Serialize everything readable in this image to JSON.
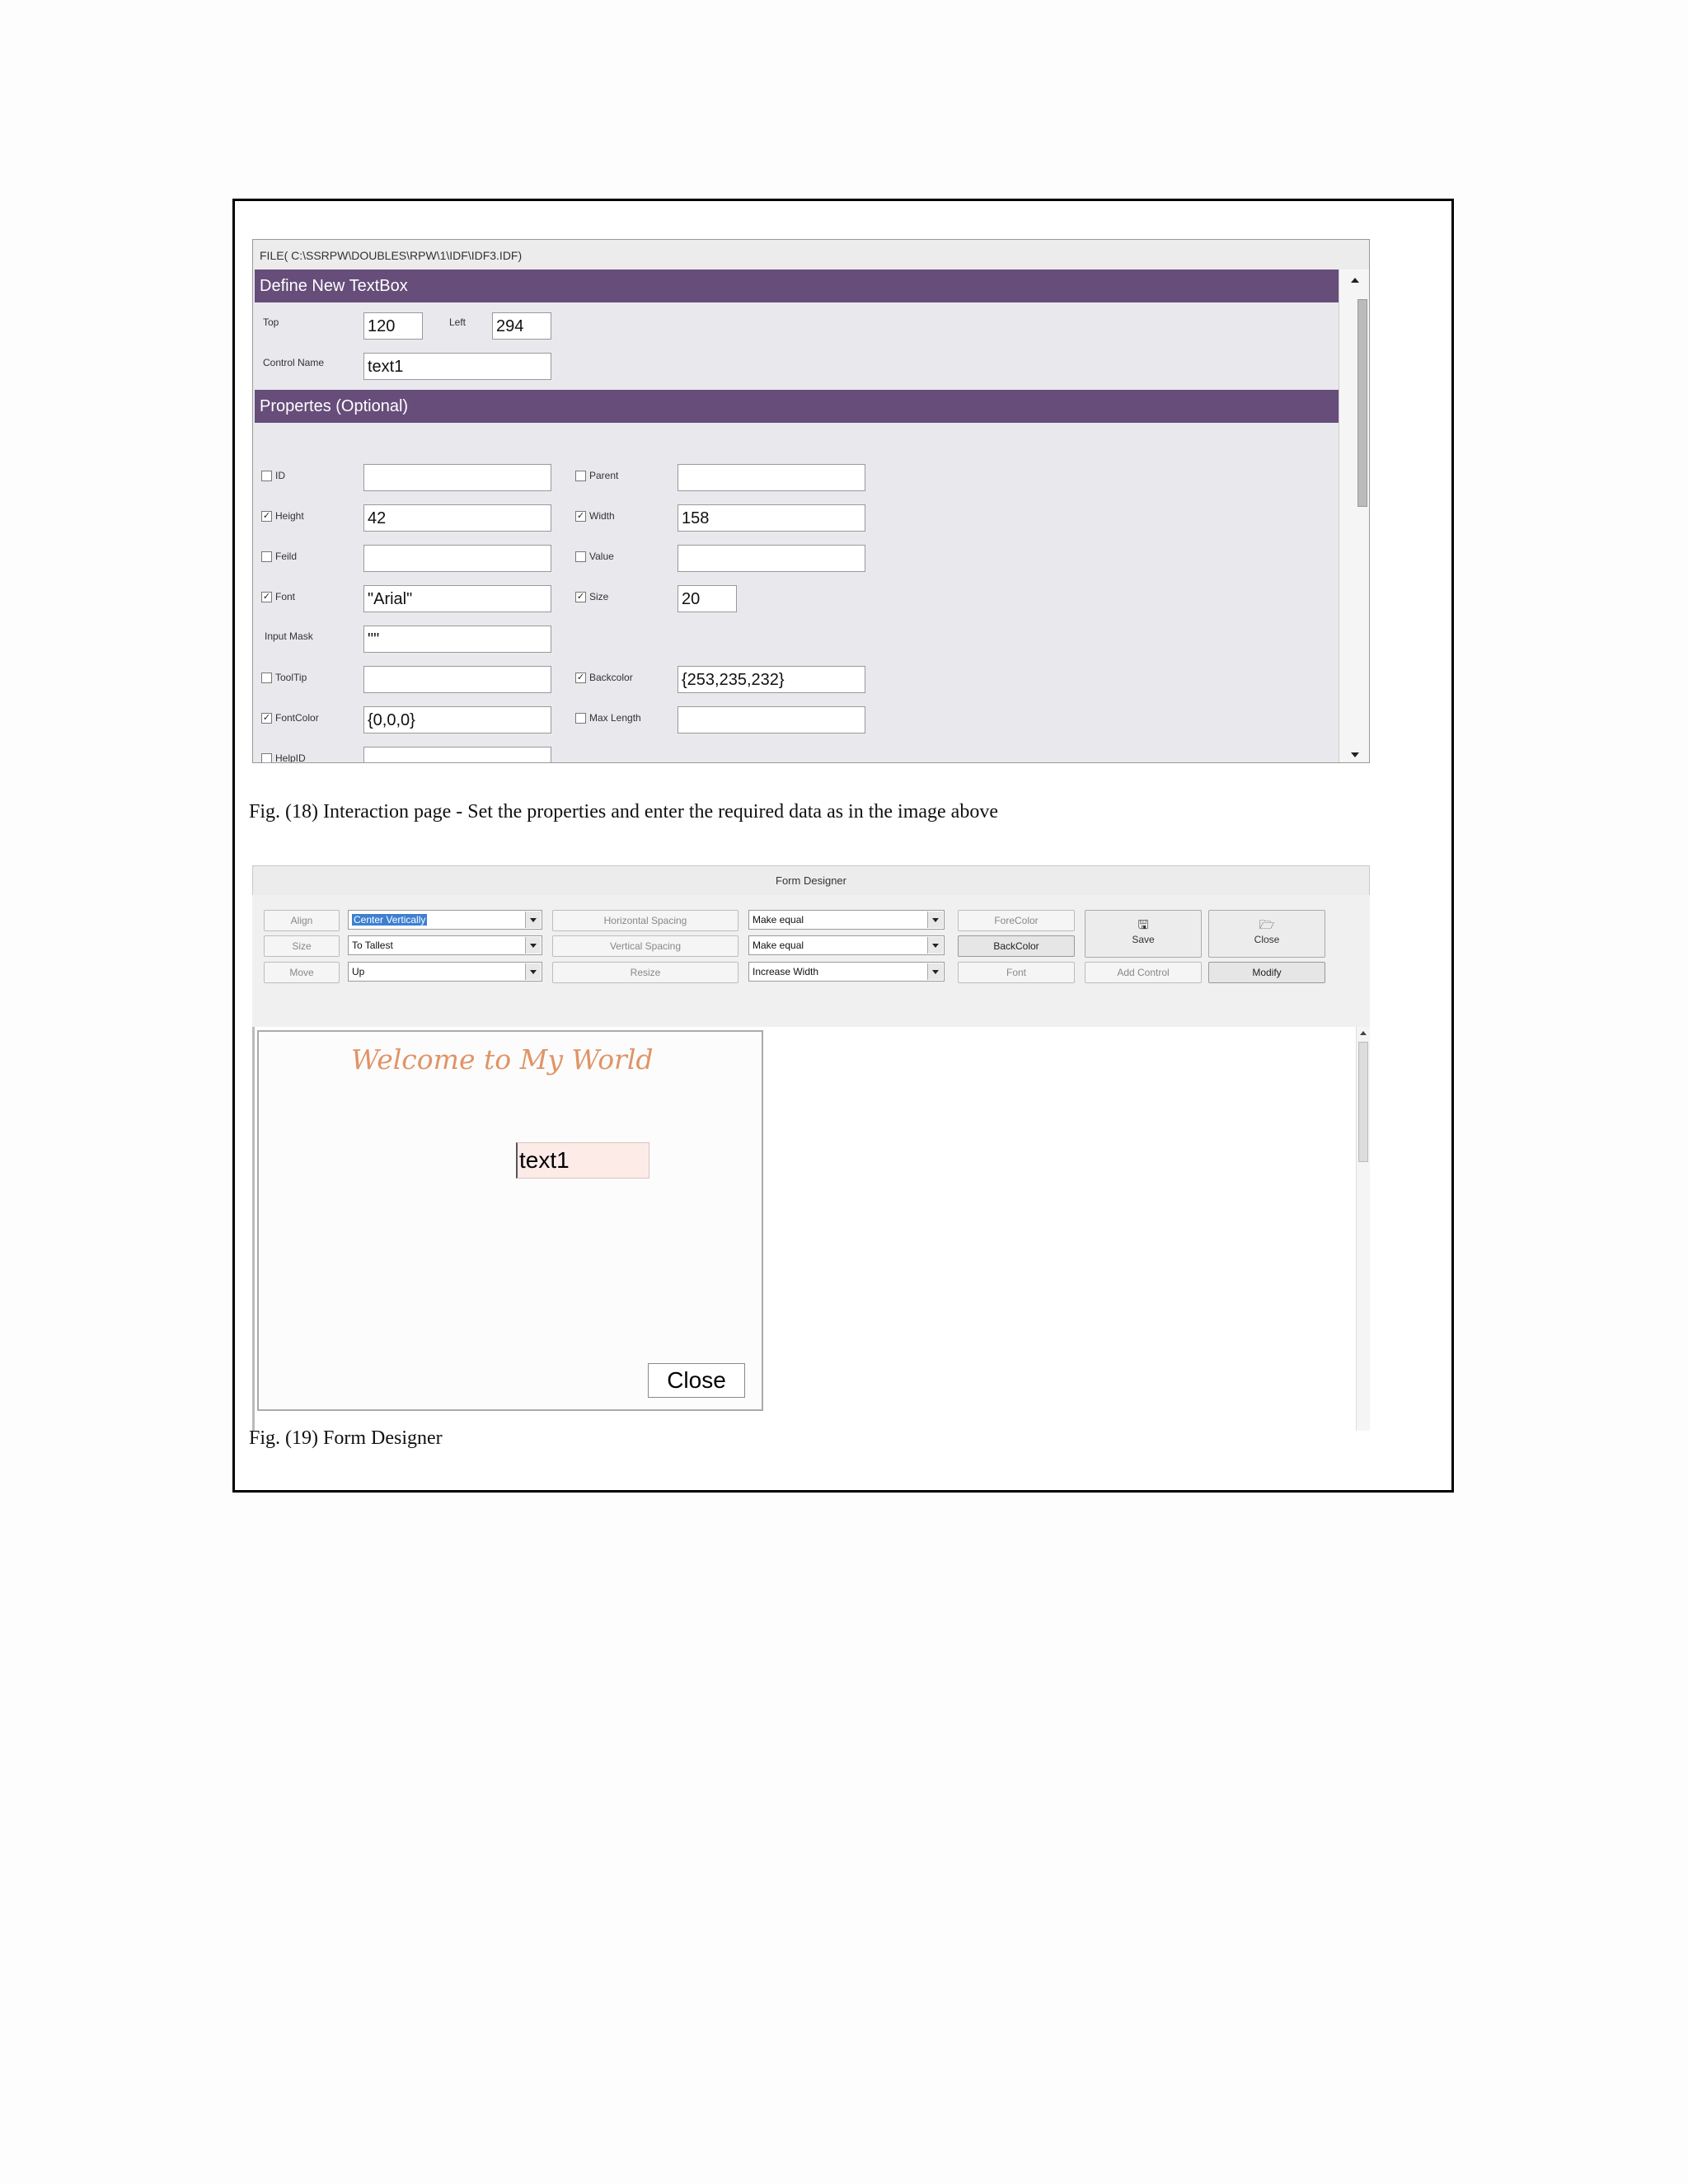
{
  "fig18": {
    "window_title": "FILE( C:\\SSRPW\\DOUBLES\\RPW\\1\\IDF\\IDF3.IDF)",
    "section1_title": "Define New TextBox",
    "top_label": "Top",
    "top_value": "120",
    "left_label": "Left",
    "left_value": "294",
    "control_name_label": "Control Name",
    "control_name_value": "text1",
    "section2_title": "Propertes (Optional)",
    "props": {
      "id": {
        "label": "ID",
        "checked": false,
        "value": ""
      },
      "parent": {
        "label": "Parent",
        "checked": false,
        "value": ""
      },
      "height": {
        "label": "Height",
        "checked": true,
        "value": "42"
      },
      "width": {
        "label": "Width",
        "checked": true,
        "value": "158"
      },
      "feild": {
        "label": "Feild",
        "checked": false,
        "value": ""
      },
      "value": {
        "label": "Value",
        "checked": false,
        "value": ""
      },
      "font": {
        "label": "Font",
        "checked": true,
        "value": "\"Arial\""
      },
      "size": {
        "label": "Size",
        "checked": true,
        "value": "20"
      },
      "input_mask": {
        "label": "Input Mask",
        "value": "\"\""
      },
      "tooltip": {
        "label": "ToolTip",
        "checked": false,
        "value": ""
      },
      "backcolor": {
        "label": "Backcolor",
        "checked": true,
        "value": "{253,235,232}"
      },
      "fontcolor": {
        "label": "FontColor",
        "checked": true,
        "value": "{0,0,0}"
      },
      "maxlength": {
        "label": "Max Length",
        "checked": false,
        "value": ""
      },
      "helpid": {
        "label": "HelpID",
        "checked": false,
        "value": ""
      }
    },
    "caption": "Fig. (18) Interaction page - Set the properties and enter the required data as in the image above"
  },
  "fig19": {
    "window_title": "Form Designer",
    "toolbar": {
      "align": "Align",
      "size": "Size",
      "move": "Move",
      "align_select": "Center Vertically",
      "size_select": "To Tallest",
      "move_select": "Up",
      "horizontal_spacing": "Horizontal Spacing",
      "vertical_spacing": "Vertical Spacing",
      "resize": "Resize",
      "hspacing_select": "Make equal",
      "vspacing_select": "Make equal",
      "resize_select": "Increase Width",
      "forecolor": "ForeColor",
      "backcolor": "BackColor",
      "font": "Font",
      "save": "Save",
      "close": "Close",
      "add_control": "Add Control",
      "modify": "Modify"
    },
    "preview": {
      "welcome": "Welcome to My World",
      "textbox": "text1",
      "close_button": "Close"
    },
    "caption": "Fig. (19) Form Designer"
  },
  "colors": {
    "section_bar": "#664d7a",
    "textbox_back": "#fdebe8",
    "welcome_text": "#e09467",
    "selection": "#3d7fd1"
  }
}
